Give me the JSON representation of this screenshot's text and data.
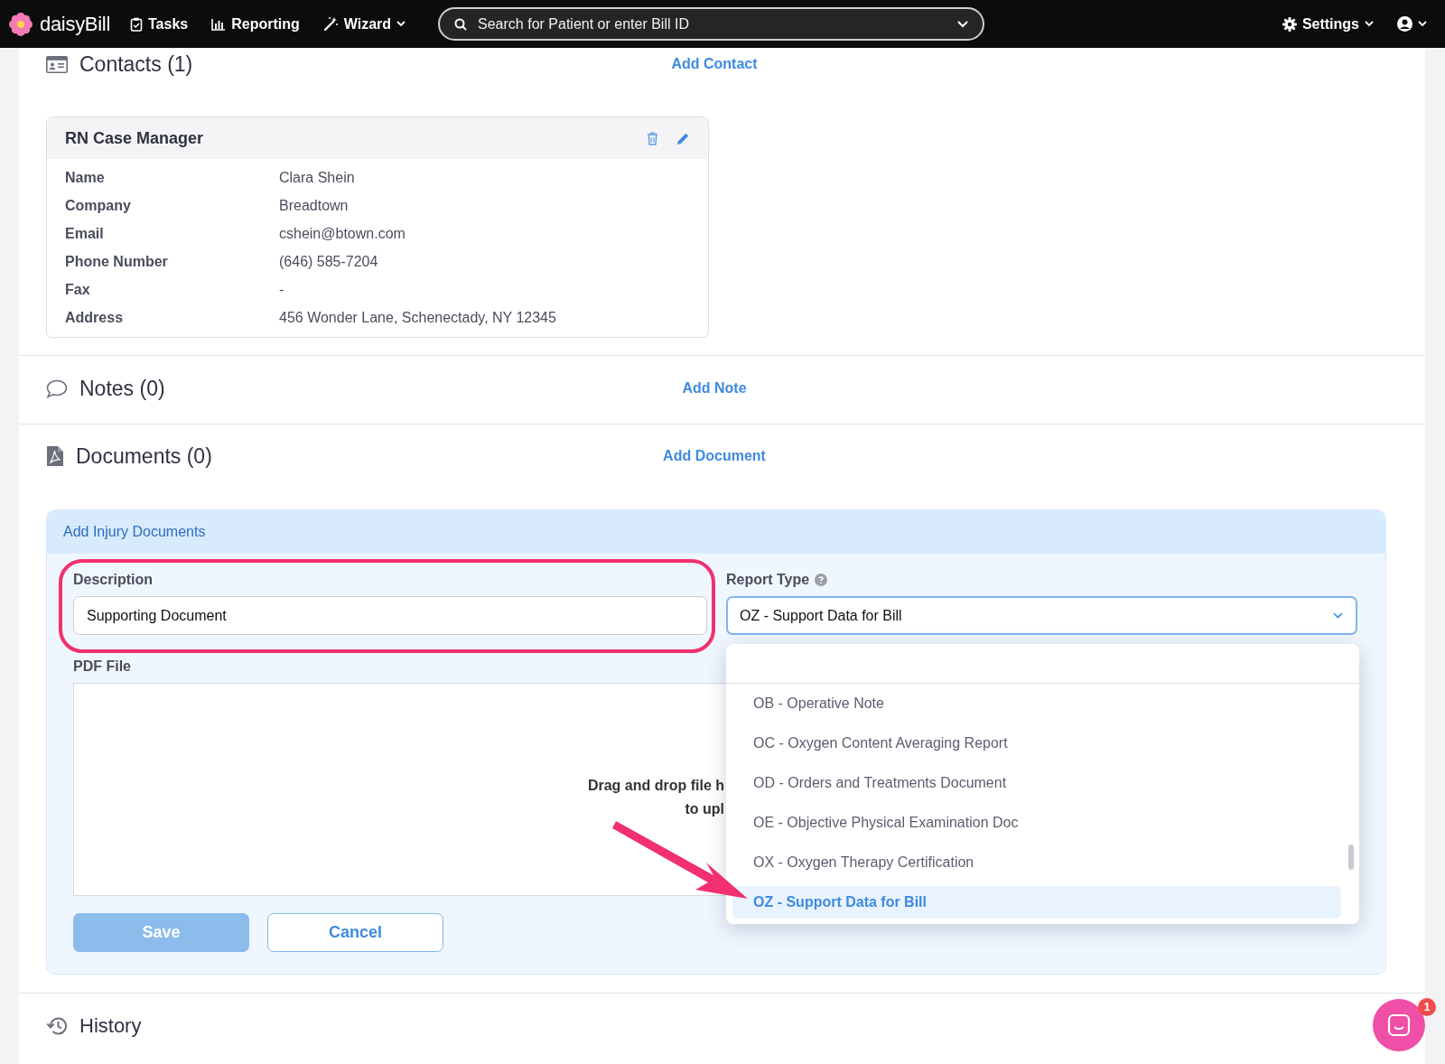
{
  "nav": {
    "logo": "daisy**Bill**",
    "items": [
      {
        "label": "Tasks",
        "kind": "tasks",
        "has_menu": false
      },
      {
        "label": "Reporting",
        "kind": "reporting",
        "has_menu": false
      },
      {
        "label": "Wizard",
        "kind": "wizard",
        "has_menu": true
      }
    ],
    "search": {
      "placeholder": "Search for Patient or enter Bill ID"
    },
    "settings": "Settings"
  },
  "contacts": {
    "title": "Contacts (1)",
    "action": "Add Contact",
    "card": {
      "title": "RN Case Manager",
      "fields": [
        {
          "label": "Name",
          "value": "Clara Shein"
        },
        {
          "label": "Company",
          "value": "Breadtown"
        },
        {
          "label": "Email",
          "value": "cshein@btown.com"
        },
        {
          "label": "Phone Number",
          "value": "(646) 585-7204"
        },
        {
          "label": "Fax",
          "value": "-"
        },
        {
          "label": "Address",
          "value": "456 Wonder Lane, Schenectady, NY 12345"
        }
      ]
    }
  },
  "notes": {
    "title": "Notes (0)",
    "action": "Add Note"
  },
  "documents": {
    "title": "Documents (0)",
    "action": "Add Document",
    "form": {
      "title": "Add Injury Documents",
      "description": {
        "label": "Description",
        "value": "Supporting Document"
      },
      "report_type": {
        "label": "Report Type",
        "value": "OZ - Support Data for Bill",
        "options": [
          {
            "label": "OB - Operative Note",
            "selected": false
          },
          {
            "label": "OC - Oxygen Content Averaging Report",
            "selected": false
          },
          {
            "label": "OD - Orders and Treatments Document",
            "selected": false
          },
          {
            "label": "OE - Objective Physical Examination Doc",
            "selected": false
          },
          {
            "label": "OX - Oxygen Therapy Certification",
            "selected": false
          },
          {
            "label": "OZ - Support Data for Bill",
            "selected": true
          }
        ]
      },
      "pdf": {
        "label": "PDF File",
        "drop_text": [
          "Drag and drop file h",
          "to upl"
        ]
      },
      "buttons": [
        {
          "label": "Save",
          "kind": "primary",
          "disabled": true
        },
        {
          "label": "Cancel",
          "kind": "secondary",
          "disabled": false
        }
      ]
    }
  },
  "history": {
    "title": "History"
  },
  "chat": {
    "badge": "1"
  }
}
